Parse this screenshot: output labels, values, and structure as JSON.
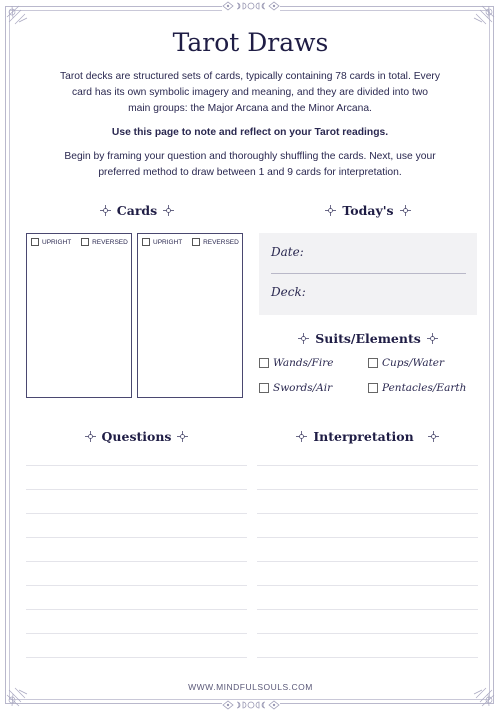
{
  "title": "Tarot Draws",
  "intro": {
    "paragraph1": "Tarot decks are structured sets of cards, typically containing 78 cards in total. Every card has its own symbolic imagery and meaning, and they are divided into two main groups: the Major Arcana and the Minor Arcana.",
    "paragraph2": "Use this page to note and reflect on your Tarot readings.",
    "paragraph3": "Begin by framing your question and thoroughly shuffling the cards. Next, use your preferred method to draw between 1 and 9 cards for interpretation."
  },
  "cards": {
    "heading": "Cards",
    "slots": [
      {
        "upright_label": "UPRIGHT",
        "reversed_label": "REVERSED"
      },
      {
        "upright_label": "UPRIGHT",
        "reversed_label": "REVERSED"
      }
    ]
  },
  "todays": {
    "heading": "Today's",
    "date_label": "Date:",
    "deck_label": "Deck:"
  },
  "suits": {
    "heading": "Suits/Elements",
    "options": [
      "Wands/Fire",
      "Cups/Water",
      "Swords/Air",
      "Pentacles/Earth"
    ]
  },
  "questions": {
    "heading": "Questions",
    "line_count": 9
  },
  "interpretation": {
    "heading": "Interpretation",
    "line_count": 9
  },
  "footer": "WWW.MINDFULSOULS.COM",
  "colors": {
    "ink": "#1f1d45",
    "frame": "#b9b8cc",
    "box_bg": "#f2f2f4",
    "rule": "#e4e4ea"
  }
}
